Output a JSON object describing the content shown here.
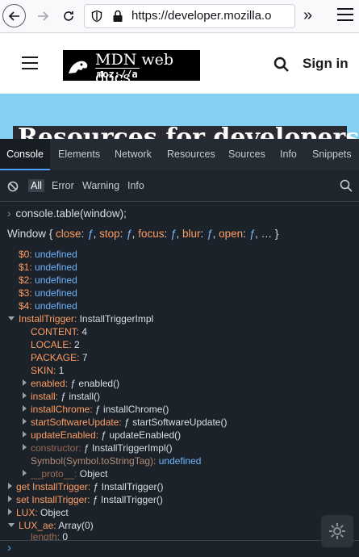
{
  "browser": {
    "url": "https://developer.mozilla.o",
    "icons": [
      "back-icon",
      "forward-icon",
      "reload-icon",
      "shield-icon",
      "lock-icon",
      "overflow-icon",
      "menu-icon"
    ]
  },
  "mdn": {
    "logo_title": "MDN web docs",
    "logo_sub": "moz://a",
    "signin": "Sign in",
    "banner_heading": "Resources for developers"
  },
  "devtools": {
    "tabs": [
      "Console",
      "Elements",
      "Network",
      "Resources",
      "Sources",
      "Info",
      "Snippets"
    ],
    "active_tab": "Console",
    "filters": [
      "All",
      "Error",
      "Warning",
      "Info"
    ],
    "active_filter": "All"
  },
  "console": {
    "command": "console.table(window);",
    "window_summary": {
      "prefix": "Window {",
      "entries": [
        {
          "key": "close",
          "val": "ƒ"
        },
        {
          "key": "stop",
          "val": "ƒ"
        },
        {
          "key": "focus",
          "val": "ƒ"
        },
        {
          "key": "blur",
          "val": "ƒ"
        },
        {
          "key": "open",
          "val": "ƒ"
        }
      ],
      "suffix": "… }"
    },
    "vars": [
      {
        "key": "$0:",
        "val": "undefined"
      },
      {
        "key": "$1:",
        "val": "undefined"
      },
      {
        "key": "$2:",
        "val": "undefined"
      },
      {
        "key": "$3:",
        "val": "undefined"
      },
      {
        "key": "$4:",
        "val": "undefined"
      }
    ],
    "install_trigger": {
      "key": "InstallTrigger:",
      "val": "InstallTriggerImpl"
    },
    "constants": [
      {
        "key": "CONTENT:",
        "val": "4"
      },
      {
        "key": "LOCALE:",
        "val": "2"
      },
      {
        "key": "PACKAGE:",
        "val": "7"
      },
      {
        "key": "SKIN:",
        "val": "1"
      }
    ],
    "methods": [
      {
        "key": "enabled:",
        "val": "ƒ enabled()"
      },
      {
        "key": "install:",
        "val": "ƒ install()"
      },
      {
        "key": "installChrome:",
        "val": "ƒ installChrome()"
      },
      {
        "key": "startSoftwareUpdate:",
        "val": "ƒ startSoftwareUpdate()"
      },
      {
        "key": "updateEnabled:",
        "val": "ƒ updateEnabled()"
      },
      {
        "key": "constructor:",
        "val": "ƒ InstallTriggerImpl()"
      }
    ],
    "symbol": {
      "key": "Symbol(Symbol.toStringTag):",
      "val": "undefined"
    },
    "proto": {
      "key": "__proto__:",
      "val": "Object"
    },
    "accessors": [
      {
        "key": "get InstallTrigger:",
        "val": "ƒ InstallTrigger()"
      },
      {
        "key": "set InstallTrigger:",
        "val": "ƒ InstallTrigger()"
      }
    ],
    "lux": {
      "key": "LUX:",
      "val": "Object"
    },
    "lux_ae": {
      "key": "LUX_ae:",
      "val": "Array(0)"
    },
    "length": {
      "key": "length:",
      "val": "0"
    }
  }
}
